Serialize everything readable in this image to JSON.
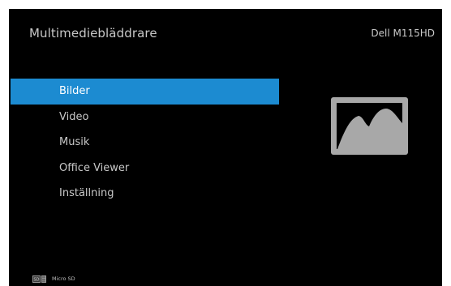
{
  "header": {
    "title": "Multimediebläddrare",
    "model": "Dell M115HD"
  },
  "menu": {
    "items": [
      {
        "label": "Bilder",
        "selected": true
      },
      {
        "label": "Video",
        "selected": false
      },
      {
        "label": "Musik",
        "selected": false
      },
      {
        "label": "Office Viewer",
        "selected": false
      },
      {
        "label": "Inställning",
        "selected": false
      }
    ]
  },
  "preview": {
    "icon": "picture-icon"
  },
  "footer": {
    "storage_icon": "micro-sd-icon",
    "storage_label": "Micro SD"
  },
  "colors": {
    "background": "#000000",
    "selection": "#1c8bd1",
    "text": "#c8c8c8",
    "icon": "#a8a8a8"
  }
}
